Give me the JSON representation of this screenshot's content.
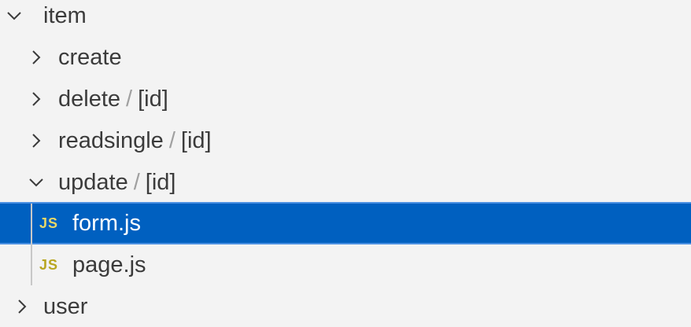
{
  "explorer": {
    "folder_item": {
      "label": "item",
      "expanded": true,
      "icon": "chevron-down-icon"
    },
    "create": {
      "label": "create",
      "expanded": false,
      "icon": "chevron-right-icon"
    },
    "delete": {
      "label": "delete",
      "separator": "/",
      "sub": "[id]",
      "expanded": false,
      "icon": "chevron-right-icon"
    },
    "readsingle": {
      "label": "readsingle",
      "separator": "/",
      "sub": "[id]",
      "expanded": false,
      "icon": "chevron-right-icon"
    },
    "update": {
      "label": "update",
      "separator": "/",
      "sub": "[id]",
      "expanded": true,
      "icon": "chevron-down-icon"
    },
    "form_js": {
      "badge": "JS",
      "label": "form.js",
      "selected": true
    },
    "page_js": {
      "badge": "JS",
      "label": "page.js",
      "selected": false
    },
    "folder_user": {
      "label": "user",
      "expanded": false,
      "icon": "chevron-right-icon"
    }
  },
  "colors": {
    "background": "#f3f3f3",
    "selection": "#0060c0",
    "selection_border": "#4a90e2",
    "js_badge": "#b8a620",
    "text": "#3b3b3b",
    "separator": "#a0a0a0"
  }
}
